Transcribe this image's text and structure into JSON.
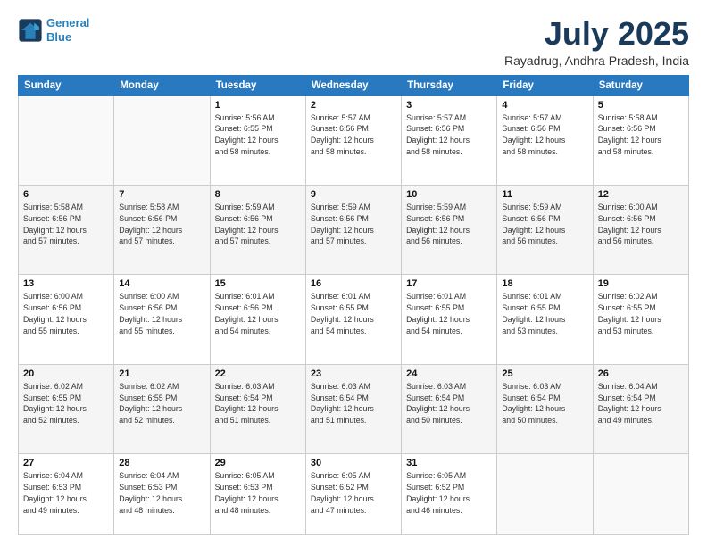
{
  "logo": {
    "line1": "General",
    "line2": "Blue"
  },
  "title": "July 2025",
  "subtitle": "Rayadrug, Andhra Pradesh, India",
  "headers": [
    "Sunday",
    "Monday",
    "Tuesday",
    "Wednesday",
    "Thursday",
    "Friday",
    "Saturday"
  ],
  "weeks": [
    [
      {
        "day": "",
        "info": ""
      },
      {
        "day": "",
        "info": ""
      },
      {
        "day": "1",
        "info": "Sunrise: 5:56 AM\nSunset: 6:55 PM\nDaylight: 12 hours\nand 58 minutes."
      },
      {
        "day": "2",
        "info": "Sunrise: 5:57 AM\nSunset: 6:56 PM\nDaylight: 12 hours\nand 58 minutes."
      },
      {
        "day": "3",
        "info": "Sunrise: 5:57 AM\nSunset: 6:56 PM\nDaylight: 12 hours\nand 58 minutes."
      },
      {
        "day": "4",
        "info": "Sunrise: 5:57 AM\nSunset: 6:56 PM\nDaylight: 12 hours\nand 58 minutes."
      },
      {
        "day": "5",
        "info": "Sunrise: 5:58 AM\nSunset: 6:56 PM\nDaylight: 12 hours\nand 58 minutes."
      }
    ],
    [
      {
        "day": "6",
        "info": "Sunrise: 5:58 AM\nSunset: 6:56 PM\nDaylight: 12 hours\nand 57 minutes."
      },
      {
        "day": "7",
        "info": "Sunrise: 5:58 AM\nSunset: 6:56 PM\nDaylight: 12 hours\nand 57 minutes."
      },
      {
        "day": "8",
        "info": "Sunrise: 5:59 AM\nSunset: 6:56 PM\nDaylight: 12 hours\nand 57 minutes."
      },
      {
        "day": "9",
        "info": "Sunrise: 5:59 AM\nSunset: 6:56 PM\nDaylight: 12 hours\nand 57 minutes."
      },
      {
        "day": "10",
        "info": "Sunrise: 5:59 AM\nSunset: 6:56 PM\nDaylight: 12 hours\nand 56 minutes."
      },
      {
        "day": "11",
        "info": "Sunrise: 5:59 AM\nSunset: 6:56 PM\nDaylight: 12 hours\nand 56 minutes."
      },
      {
        "day": "12",
        "info": "Sunrise: 6:00 AM\nSunset: 6:56 PM\nDaylight: 12 hours\nand 56 minutes."
      }
    ],
    [
      {
        "day": "13",
        "info": "Sunrise: 6:00 AM\nSunset: 6:56 PM\nDaylight: 12 hours\nand 55 minutes."
      },
      {
        "day": "14",
        "info": "Sunrise: 6:00 AM\nSunset: 6:56 PM\nDaylight: 12 hours\nand 55 minutes."
      },
      {
        "day": "15",
        "info": "Sunrise: 6:01 AM\nSunset: 6:56 PM\nDaylight: 12 hours\nand 54 minutes."
      },
      {
        "day": "16",
        "info": "Sunrise: 6:01 AM\nSunset: 6:55 PM\nDaylight: 12 hours\nand 54 minutes."
      },
      {
        "day": "17",
        "info": "Sunrise: 6:01 AM\nSunset: 6:55 PM\nDaylight: 12 hours\nand 54 minutes."
      },
      {
        "day": "18",
        "info": "Sunrise: 6:01 AM\nSunset: 6:55 PM\nDaylight: 12 hours\nand 53 minutes."
      },
      {
        "day": "19",
        "info": "Sunrise: 6:02 AM\nSunset: 6:55 PM\nDaylight: 12 hours\nand 53 minutes."
      }
    ],
    [
      {
        "day": "20",
        "info": "Sunrise: 6:02 AM\nSunset: 6:55 PM\nDaylight: 12 hours\nand 52 minutes."
      },
      {
        "day": "21",
        "info": "Sunrise: 6:02 AM\nSunset: 6:55 PM\nDaylight: 12 hours\nand 52 minutes."
      },
      {
        "day": "22",
        "info": "Sunrise: 6:03 AM\nSunset: 6:54 PM\nDaylight: 12 hours\nand 51 minutes."
      },
      {
        "day": "23",
        "info": "Sunrise: 6:03 AM\nSunset: 6:54 PM\nDaylight: 12 hours\nand 51 minutes."
      },
      {
        "day": "24",
        "info": "Sunrise: 6:03 AM\nSunset: 6:54 PM\nDaylight: 12 hours\nand 50 minutes."
      },
      {
        "day": "25",
        "info": "Sunrise: 6:03 AM\nSunset: 6:54 PM\nDaylight: 12 hours\nand 50 minutes."
      },
      {
        "day": "26",
        "info": "Sunrise: 6:04 AM\nSunset: 6:54 PM\nDaylight: 12 hours\nand 49 minutes."
      }
    ],
    [
      {
        "day": "27",
        "info": "Sunrise: 6:04 AM\nSunset: 6:53 PM\nDaylight: 12 hours\nand 49 minutes."
      },
      {
        "day": "28",
        "info": "Sunrise: 6:04 AM\nSunset: 6:53 PM\nDaylight: 12 hours\nand 48 minutes."
      },
      {
        "day": "29",
        "info": "Sunrise: 6:05 AM\nSunset: 6:53 PM\nDaylight: 12 hours\nand 48 minutes."
      },
      {
        "day": "30",
        "info": "Sunrise: 6:05 AM\nSunset: 6:52 PM\nDaylight: 12 hours\nand 47 minutes."
      },
      {
        "day": "31",
        "info": "Sunrise: 6:05 AM\nSunset: 6:52 PM\nDaylight: 12 hours\nand 46 minutes."
      },
      {
        "day": "",
        "info": ""
      },
      {
        "day": "",
        "info": ""
      }
    ]
  ]
}
